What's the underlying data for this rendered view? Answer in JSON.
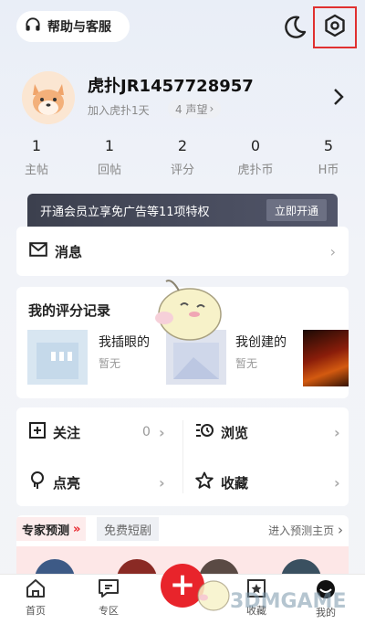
{
  "top_bar": {
    "help_label": "帮助与客服",
    "icons": [
      "headset-icon",
      "moon-icon",
      "gear-icon"
    ]
  },
  "profile": {
    "username": "虎扑JR1457728957",
    "joined": "加入虎扑1天",
    "fame": "4 声望"
  },
  "stats": [
    {
      "num": "1",
      "label": "主帖"
    },
    {
      "num": "1",
      "label": "回帖"
    },
    {
      "num": "2",
      "label": "评分"
    },
    {
      "num": "0",
      "label": "虎扑币"
    },
    {
      "num": "5",
      "label": "H币"
    }
  ],
  "vip": {
    "text": "开通会员立享免广告等11项特权",
    "button": "立即开通"
  },
  "messages": {
    "label": "消息"
  },
  "score_records": {
    "title": "我的评分记录",
    "items": [
      {
        "title": "我插眼的",
        "sub": "暂无"
      },
      {
        "title": "我创建的",
        "sub": "暂无"
      }
    ]
  },
  "grid": {
    "follow": {
      "label": "关注",
      "count": "0"
    },
    "browse": {
      "label": "浏览"
    },
    "like": {
      "label": "点亮"
    },
    "favorite": {
      "label": "收藏"
    }
  },
  "expert": {
    "tab_active": "专家预测",
    "tab_other": "免费短剧",
    "link": "进入预测主页"
  },
  "nav": {
    "home": "首页",
    "zone": "专区",
    "collect": "收藏",
    "mine": "我的"
  },
  "watermark": "3DMGAME",
  "colors": {
    "accent_red": "#e8242b",
    "vip_bg": "#3c404e",
    "highlight_border": "#e03030"
  }
}
